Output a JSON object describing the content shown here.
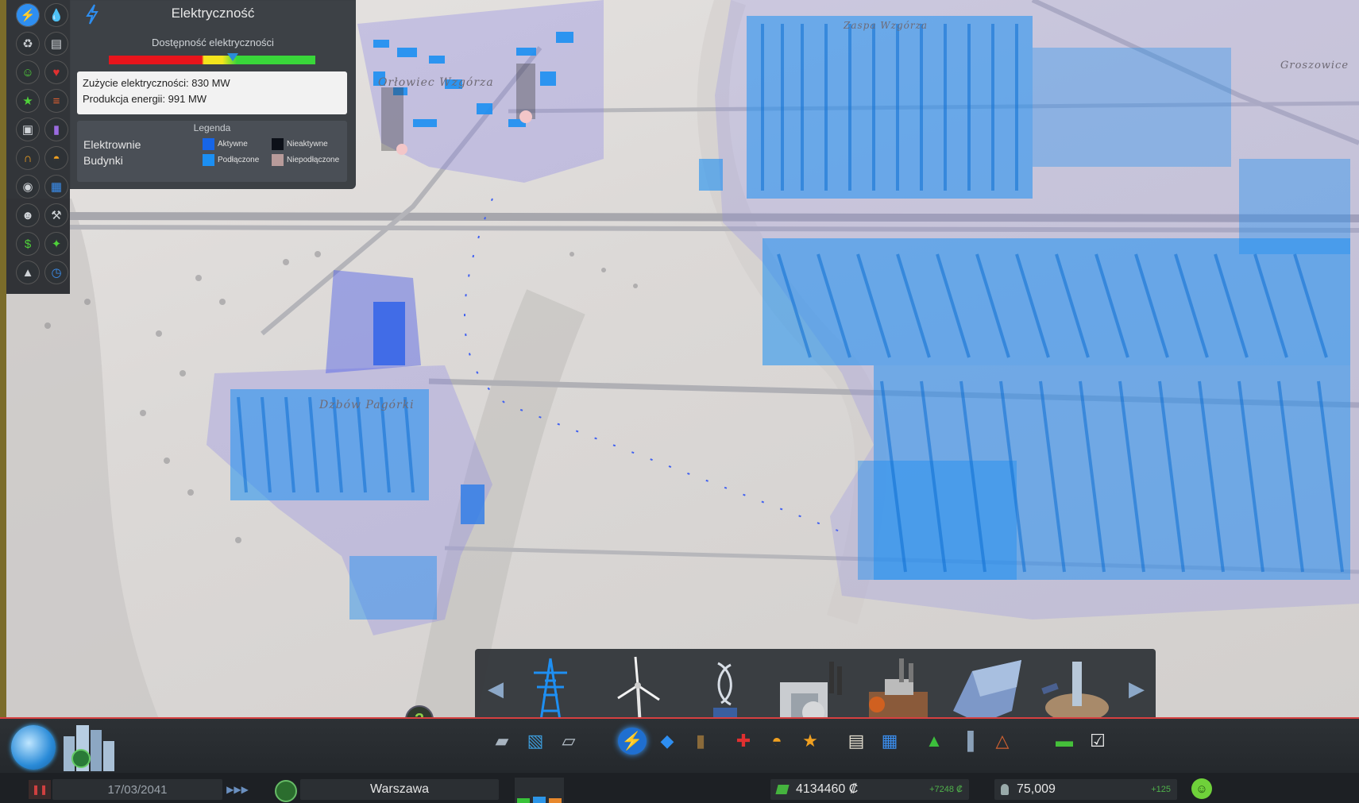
{
  "map": {
    "districts": [
      "Orłowiec Wzgórza",
      "Zaspa Wzgórza",
      "Groszowice",
      "Dzbów Pagórki"
    ]
  },
  "info_sidebar": {
    "buttons": [
      {
        "name": "electricity-view-button",
        "icon": "electricity-icon"
      },
      {
        "name": "water-view-button",
        "icon": "water-drop-icon"
      },
      {
        "name": "garbage-view-button",
        "icon": "garbage-truck-icon"
      },
      {
        "name": "education-view-button",
        "icon": "book-icon"
      },
      {
        "name": "happiness-view-button",
        "icon": "smiley-icon"
      },
      {
        "name": "health-view-button",
        "icon": "heart-icon"
      },
      {
        "name": "attractiveness-view-button",
        "icon": "star-icon"
      },
      {
        "name": "wind-view-button",
        "icon": "windsock-icon"
      },
      {
        "name": "traffic-view-button",
        "icon": "car-icon"
      },
      {
        "name": "pollution-view-button",
        "icon": "barrel-icon"
      },
      {
        "name": "noise-view-button",
        "icon": "headphones-icon"
      },
      {
        "name": "fire-view-button",
        "icon": "fire-helmet-icon"
      },
      {
        "name": "crime-view-button",
        "icon": "robber-icon"
      },
      {
        "name": "transport-view-button",
        "icon": "bus-icon"
      },
      {
        "name": "population-view-button",
        "icon": "person-icon"
      },
      {
        "name": "resources-view-button",
        "icon": "drill-icon"
      },
      {
        "name": "land-value-view-button",
        "icon": "dollar-icon"
      },
      {
        "name": "districts-view-button",
        "icon": "map-pieces-icon"
      },
      {
        "name": "terrain-view-button",
        "icon": "terrain-icon"
      },
      {
        "name": "levels-view-button",
        "icon": "clock-icon"
      }
    ]
  },
  "electricity_panel": {
    "title": "Elektryczność",
    "availability_label": "Dostępność elektryczności",
    "availability_level": 0.6,
    "consumption": "Zużycie elektryczności: 830 MW",
    "production": "Produkcja energii: 991 MW",
    "legend": {
      "title": "Legenda",
      "rows": [
        "Elektrownie",
        "Budynki"
      ],
      "items": [
        {
          "label": "Aktywne",
          "color": "#1665e8"
        },
        {
          "label": "Nieaktywne",
          "color": "#0c1018"
        },
        {
          "label": "Podłączone",
          "color": "#1c8ff2"
        },
        {
          "label": "Niepodłączone",
          "color": "#b89b9a"
        }
      ]
    }
  },
  "build_panel": {
    "items": [
      {
        "name": "power-line-item",
        "icon": "power-pylon-icon"
      },
      {
        "name": "wind-turbine-item",
        "icon": "wind-turbine-icon"
      },
      {
        "name": "advanced-wind-turbine-item",
        "icon": "vertical-turbine-icon"
      },
      {
        "name": "coal-plant-item",
        "icon": "coal-plant-icon"
      },
      {
        "name": "oil-plant-item",
        "icon": "oil-plant-icon"
      },
      {
        "name": "hydro-dam-item",
        "icon": "dam-icon"
      },
      {
        "name": "solar-plant-item",
        "icon": "solar-tower-icon"
      }
    ]
  },
  "bottom_toolbar": {
    "categories": [
      {
        "name": "roads-category",
        "icon": "road-icon"
      },
      {
        "name": "zoning-category",
        "icon": "zoning-icon"
      },
      {
        "name": "districts-category",
        "icon": "district-icon"
      },
      {
        "name": "electricity-category",
        "icon": "lightning-icon"
      },
      {
        "name": "water-category",
        "icon": "water-drop-icon"
      },
      {
        "name": "garbage-category",
        "icon": "garbage-icon"
      },
      {
        "name": "healthcare-category",
        "icon": "medical-icon"
      },
      {
        "name": "fire-category",
        "icon": "fire-helmet-icon"
      },
      {
        "name": "police-category",
        "icon": "police-badge-icon"
      },
      {
        "name": "education-category",
        "icon": "book-icon"
      },
      {
        "name": "public-transport-category",
        "icon": "bus-icon"
      },
      {
        "name": "parks-category",
        "icon": "tree-icon"
      },
      {
        "name": "unique-buildings-category",
        "icon": "monument-icon"
      },
      {
        "name": "monuments-category",
        "icon": "pyramid-icon"
      },
      {
        "name": "money-category",
        "icon": "money-icon"
      },
      {
        "name": "milestones-category",
        "icon": "checklist-icon"
      }
    ]
  },
  "status": {
    "date": "17/03/2041",
    "city_name": "Warszawa",
    "money": "4134460 ₡",
    "money_delta": "+7248 ₡",
    "population": "75,009",
    "population_delta": "+125"
  }
}
